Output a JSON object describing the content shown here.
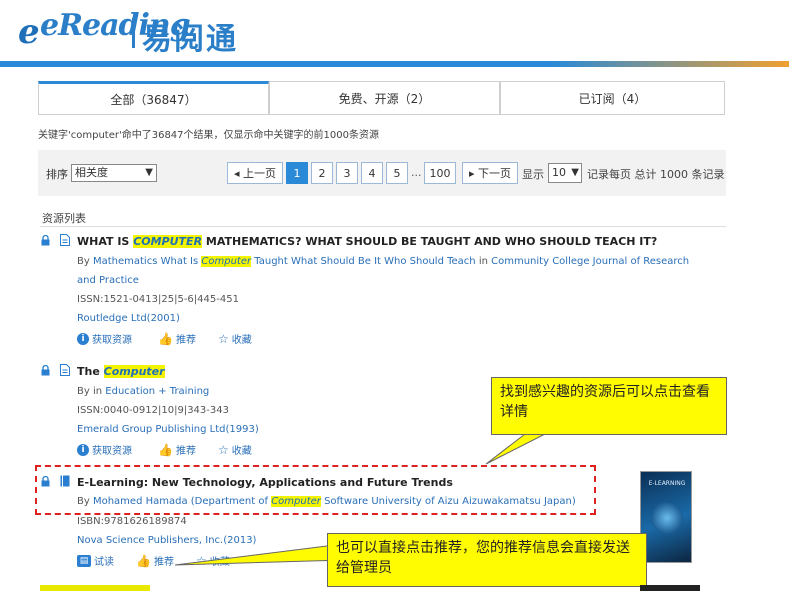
{
  "header": {
    "logo_latin": "eReading",
    "logo_cn": "易阅通"
  },
  "tabs": [
    {
      "label": "全部（36847）"
    },
    {
      "label": "免费、开源（2）"
    },
    {
      "label": "已订阅（4）"
    }
  ],
  "result_note": "关键字'computer'命中了36847个结果，仅显示命中关键字的前1000条资源",
  "toolbar": {
    "sort_label": "排序",
    "sort_value": "相关度",
    "prev_label": "◂ 上一页",
    "pages": [
      "1",
      "2",
      "3",
      "4",
      "5",
      "...",
      "100"
    ],
    "current_page": "1",
    "next_label": "▸ 下一页",
    "per_label": "显示",
    "per_value": "10",
    "per_suffix": "记录每页 总计 1000 条记录"
  },
  "list_title": "资源列表",
  "records": [
    {
      "title_pre": "WHAT IS ",
      "title_hl": "COMPUTER",
      "title_post": " MATHEMATICS? WHAT SHOULD BE TAUGHT AND WHO SHOULD TEACH IT?",
      "by_label": "By",
      "by_pre": "Mathematics What Is ",
      "by_hl": "Computer",
      "by_post": "  Taught What Should Be  It Who Should Teach",
      "in_label": "in",
      "in_value": "Community College Journal of Research",
      "in_cont": "and Practice",
      "issn": "ISSN:1521-0413|25|5-6|445-451",
      "publisher": "Routledge Ltd(2001)",
      "actions": [
        "获取资源",
        "推荐",
        "收藏"
      ]
    },
    {
      "title_pre": "The ",
      "title_hl": "Computer",
      "by_label": "By",
      "in_label": "in",
      "in_value": "Education + Training",
      "issn": "ISSN:0040-0912|10|9|343-343",
      "publisher": "Emerald Group Publishing Ltd(1993)",
      "actions": [
        "获取资源",
        "推荐",
        "收藏"
      ]
    },
    {
      "title": "E-Learning: New Technology, Applications and Future Trends",
      "by_label": "By",
      "by_pre": "Mohamed Hamada (Department of ",
      "by_hl": "Computer",
      "by_post": " Software   University of Aizu   Aizuwakamatsu   Japan)",
      "isbn": "ISBN:9781626189874",
      "publisher": "Nova Science Publishers, Inc.(2013)",
      "actions": [
        "试读",
        "推荐",
        "收藏"
      ],
      "cover_text": "E-LEARNING"
    }
  ],
  "callouts": {
    "first": "找到感兴趣的资源后可以点击查看详情",
    "second": "也可以直接点击推荐，您的推荐信息会直接发送给管理员"
  },
  "colors": {
    "brand_blue": "#2a8ad8",
    "highlight": "#f4f400",
    "link": "#2a6fb8",
    "dashed_box": "#dd2222",
    "callout_bg": "#fffb00"
  }
}
